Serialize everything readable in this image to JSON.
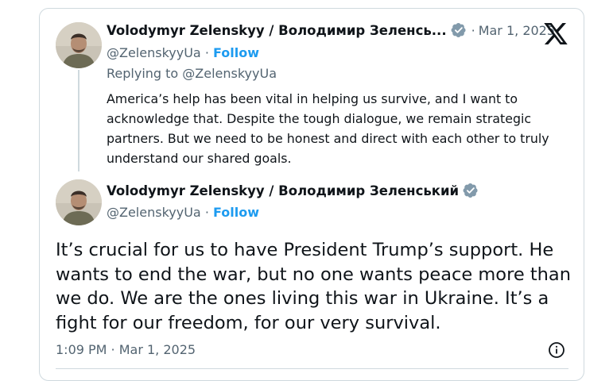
{
  "quoted_tweet": {
    "author_name": "Volodymyr Zelenskyy / Володимир Зеленсь...",
    "handle": "@ZelenskyyUa",
    "separator": "·",
    "follow_label": "Follow",
    "date": "Mar 1, 2025",
    "replying_to": "Replying to @ZelenskyyUa",
    "text": "America’s help has been vital in helping us survive, and I want to acknowledge that. Despite the tough dialogue, we remain strategic partners. But we need to be honest and direct with each other to truly understand our shared goals."
  },
  "main_tweet": {
    "author_name": "Volodymyr Zelenskyy / Володимир Зеленський",
    "handle": "@ZelenskyyUa",
    "separator": "·",
    "follow_label": "Follow",
    "text": "It’s crucial for us to have President Trump’s support. He wants to end the war, but no one wants peace more than we do. We are the ones living this war in Ukraine. It’s a fight for our freedom, for our very survival.",
    "timestamp": "1:09 PM · Mar 1, 2025"
  },
  "icons": {
    "verified": "verified-badge-icon",
    "platform": "x-logo-icon",
    "info": "info-icon"
  },
  "colors": {
    "link": "#1d9bf0",
    "secondary_text": "#536471",
    "border": "#cfd9de",
    "verified_badge": "#829aab"
  }
}
